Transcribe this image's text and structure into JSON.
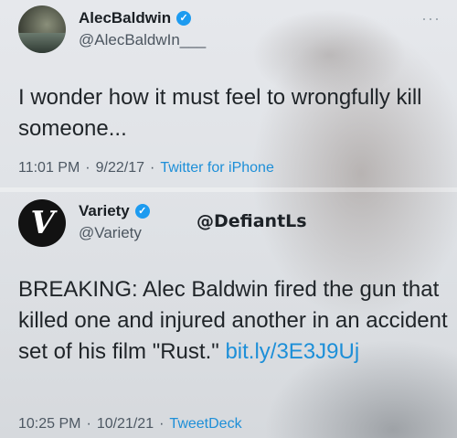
{
  "tweet1": {
    "name": "AlecBaldwin",
    "handle": "@AlecBaldwIn___",
    "text": "I wonder how it must feel to wrongfully kill someone...",
    "time": "11:01 PM",
    "date": "9/22/17",
    "source": "Twitter for iPhone",
    "more_icon": "more-icon"
  },
  "tweet2": {
    "name": "Variety",
    "handle": "@Variety",
    "text": "BREAKING: Alec Baldwin fired the gun that killed one and injured another in an accident set of his film \"Rust.\" ",
    "link": "bit.ly/3E3J9Uj",
    "time": "10:25 PM",
    "date": "10/21/21",
    "source": "TweetDeck"
  },
  "watermark": "@DefiantLs",
  "colors": {
    "verified": "#1d9bf0",
    "link": "#1d8fd8",
    "text": "#1f2428"
  }
}
